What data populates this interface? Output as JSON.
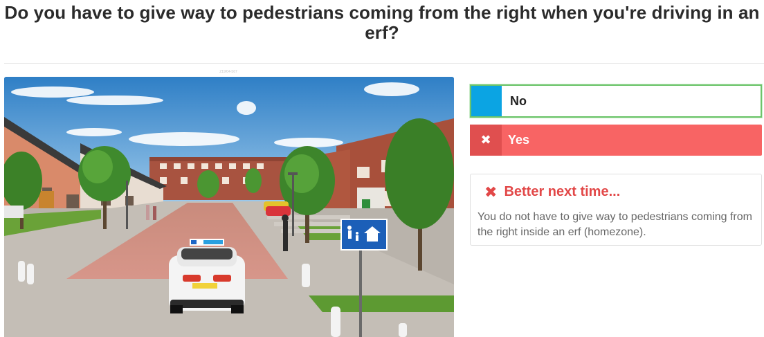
{
  "question": {
    "title": "Do you have to give way to pedestrians coming from the right when you're driving in an erf?"
  },
  "image": {
    "tag": "Z19f04-567",
    "icon": "street-scene-image"
  },
  "answers": [
    {
      "label": "No",
      "swatch_color": "#0ba4e3",
      "state": "correct-selected"
    },
    {
      "label": "Yes",
      "mark": "✖",
      "state": "wrong"
    }
  ],
  "feedback": {
    "icon": "x-icon",
    "mark": "✖",
    "title": "Better next time...",
    "body": "You do not have to give way to pedestrians coming from the right inside an erf (homezone)."
  },
  "colors": {
    "correct_border": "#6cc46a",
    "wrong_bg": "#f86464",
    "feedback_title": "#e24848"
  }
}
